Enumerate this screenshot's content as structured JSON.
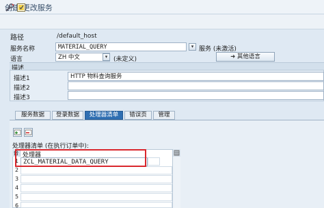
{
  "window": {
    "title": "创建/更改服务"
  },
  "form": {
    "path_label": "路径",
    "path_value": "/default_host",
    "service_name_label": "服务名称",
    "service_name_value": "MATERIAL_QUERY",
    "service_status": "服务 (未激活)",
    "language_label": "语言",
    "language_value": "ZH 中文",
    "language_note": "(未定义)",
    "other_language_button": "其他语言",
    "description_section": "描述",
    "descriptions": [
      {
        "label": "描述1",
        "value": "HTTP 物料查询服务"
      },
      {
        "label": "描述2",
        "value": ""
      },
      {
        "label": "描述3",
        "value": ""
      }
    ]
  },
  "tabs": [
    {
      "label": "服务数据",
      "active": false
    },
    {
      "label": "登录数据",
      "active": false
    },
    {
      "label": "处理器清单",
      "active": true
    },
    {
      "label": "错误页",
      "active": false
    },
    {
      "label": "管理",
      "active": false
    }
  ],
  "handler": {
    "list_label": "处理器清单 (在执行订单中):",
    "column_header": "处理器",
    "rows": [
      {
        "num": "1",
        "value": "ZCL_MATERIAL_DATA_QUERY"
      },
      {
        "num": "2",
        "value": ""
      },
      {
        "num": "3",
        "value": ""
      },
      {
        "num": "4",
        "value": ""
      },
      {
        "num": "5",
        "value": ""
      },
      {
        "num": "6",
        "value": ""
      },
      {
        "num": "7",
        "value": ""
      }
    ]
  },
  "icons": [
    "wrench-icon",
    "activate-icon",
    "insert-row-icon",
    "delete-row-icon",
    "dropdown-icon",
    "arrow-right-icon",
    "column-settings-icon"
  ],
  "colors": {
    "active_tab": "#2f6fb2",
    "highlight": "#d9262c",
    "background": "#dfe9f3"
  }
}
